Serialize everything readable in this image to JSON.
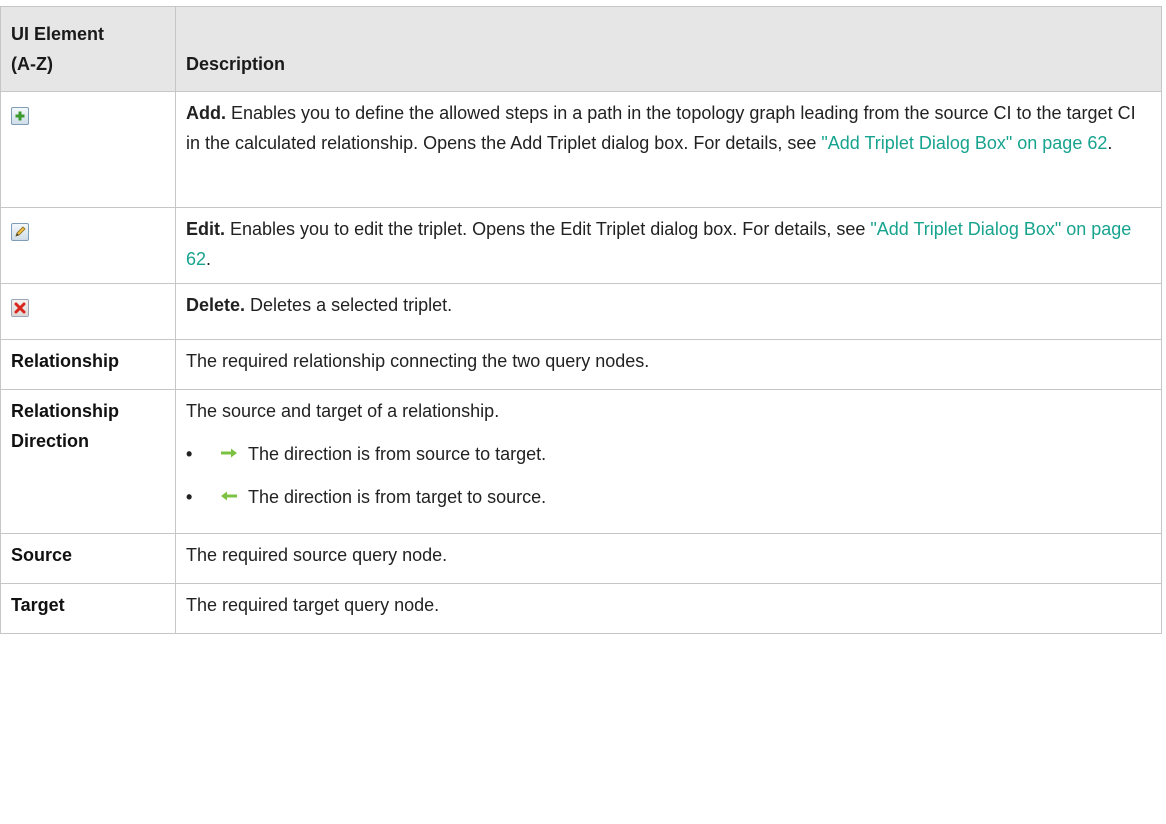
{
  "table": {
    "headers": [
      "UI Element\n(A-Z)",
      "Description"
    ],
    "header_col1_line1": "UI Element",
    "header_col1_line2": "(A-Z)",
    "header_col2": "Description"
  },
  "rows": {
    "add": {
      "icon": "add-icon",
      "label": "Add.",
      "text": " Enables you to define the allowed steps in a path in the topology graph leading from the source CI to the target CI in the calculated relationship. Opens the Add Triplet dialog box. For details, see ",
      "link": "\"Add Triplet Dialog Box\" on page 62",
      "end": "."
    },
    "edit": {
      "icon": "edit-icon",
      "label": "Edit.",
      "text": " Enables you to edit the triplet. Opens the Edit Triplet dialog box. For details, see ",
      "link": "\"Add Triplet Dialog Box\" on page 62",
      "end": "."
    },
    "delete": {
      "icon": "delete-icon",
      "label": "Delete.",
      "text": " Deletes a selected triplet."
    },
    "relationship": {
      "name": "Relationship",
      "description": "The required relationship connecting the two query nodes."
    },
    "relationship_direction": {
      "name_line1": "Relationship",
      "name_line2": "Direction",
      "description": "The source and target of a relationship.",
      "items": [
        {
          "icon": "arrow-right-icon",
          "text": "The direction is from source to target."
        },
        {
          "icon": "arrow-left-icon",
          "text": "The direction is from target to source."
        }
      ]
    },
    "source": {
      "name": "Source",
      "description": "The required source query node."
    },
    "target": {
      "name": "Target",
      "description": "The required target query node."
    }
  },
  "colors": {
    "header_bg": "#e6e6e6",
    "border": "#c6c6c6",
    "link": "#17a38e",
    "arrow": "#7cc242"
  }
}
